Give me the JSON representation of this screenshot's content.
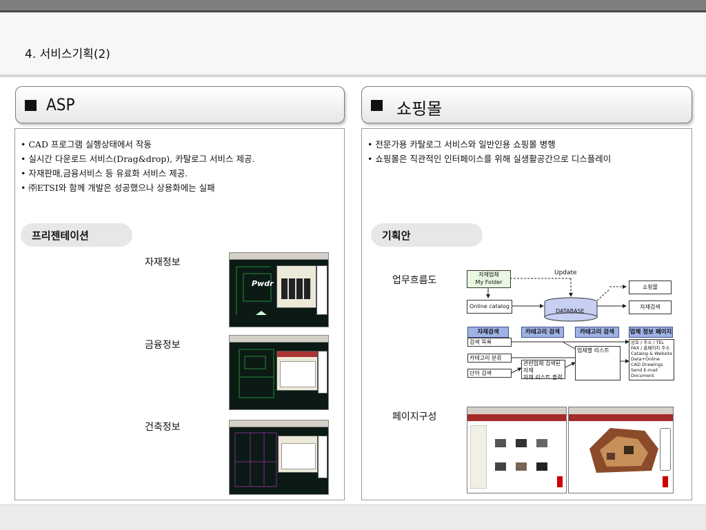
{
  "page": {
    "title": "4. 서비스기획(2)"
  },
  "asp": {
    "heading": "ASP",
    "bullets": [
      "• CAD 프로그램 실행상태에서 작동",
      "• 실시간 다운로드 서비스(Drag&drop), 카탈로그 서비스 제공.",
      "• 자재판매,금융서비스 등 유료화 서비스 제공.",
      "• ㈜ETSI와 함께 개발은 성공했으나 상용화에는 실패"
    ],
    "section_label": "프리젠테이션",
    "captions": [
      "자재정보",
      "금융정보",
      "건축정보"
    ],
    "screenshot_text": {
      "logo": "Pwdr"
    }
  },
  "shop": {
    "heading": "쇼핑몰",
    "bullets": [
      "• 전문가용 카탈로그 서비스와 일반인용 쇼핑몰 병행",
      "• 쇼핑몰은 직관적인 인터페이스를 위해 실생활공간으로 디스플레이"
    ],
    "section_label": "기획안",
    "flow_caption": "업무흐름도",
    "page_caption": "페이지구성",
    "diagram": {
      "folder": [
        "자재업체",
        "My Folder"
      ],
      "update": "Update",
      "online_catalog": "Online catalog",
      "database": "DATABASE",
      "shop_box": "쇼핑몰",
      "material_search_box": "자재검색",
      "headers": [
        "자재검색",
        "카테고리 검색",
        "카테고리 검색",
        "업체 정보 페이지"
      ],
      "rows": [
        "검색 목록",
        "카테고리 분류",
        "단어 검색"
      ],
      "mid_box": [
        "관련업체 검색된 자재",
        "자재 리스트 출력"
      ],
      "list_box": "업체별 리스트",
      "info_box": [
        "상호 / 주소 / TEL",
        "FAX / 홈페이지 주소",
        "Catalog & Website",
        "Data+Online",
        "CAD Drawings",
        "Send E-mail",
        "Document"
      ]
    }
  }
}
